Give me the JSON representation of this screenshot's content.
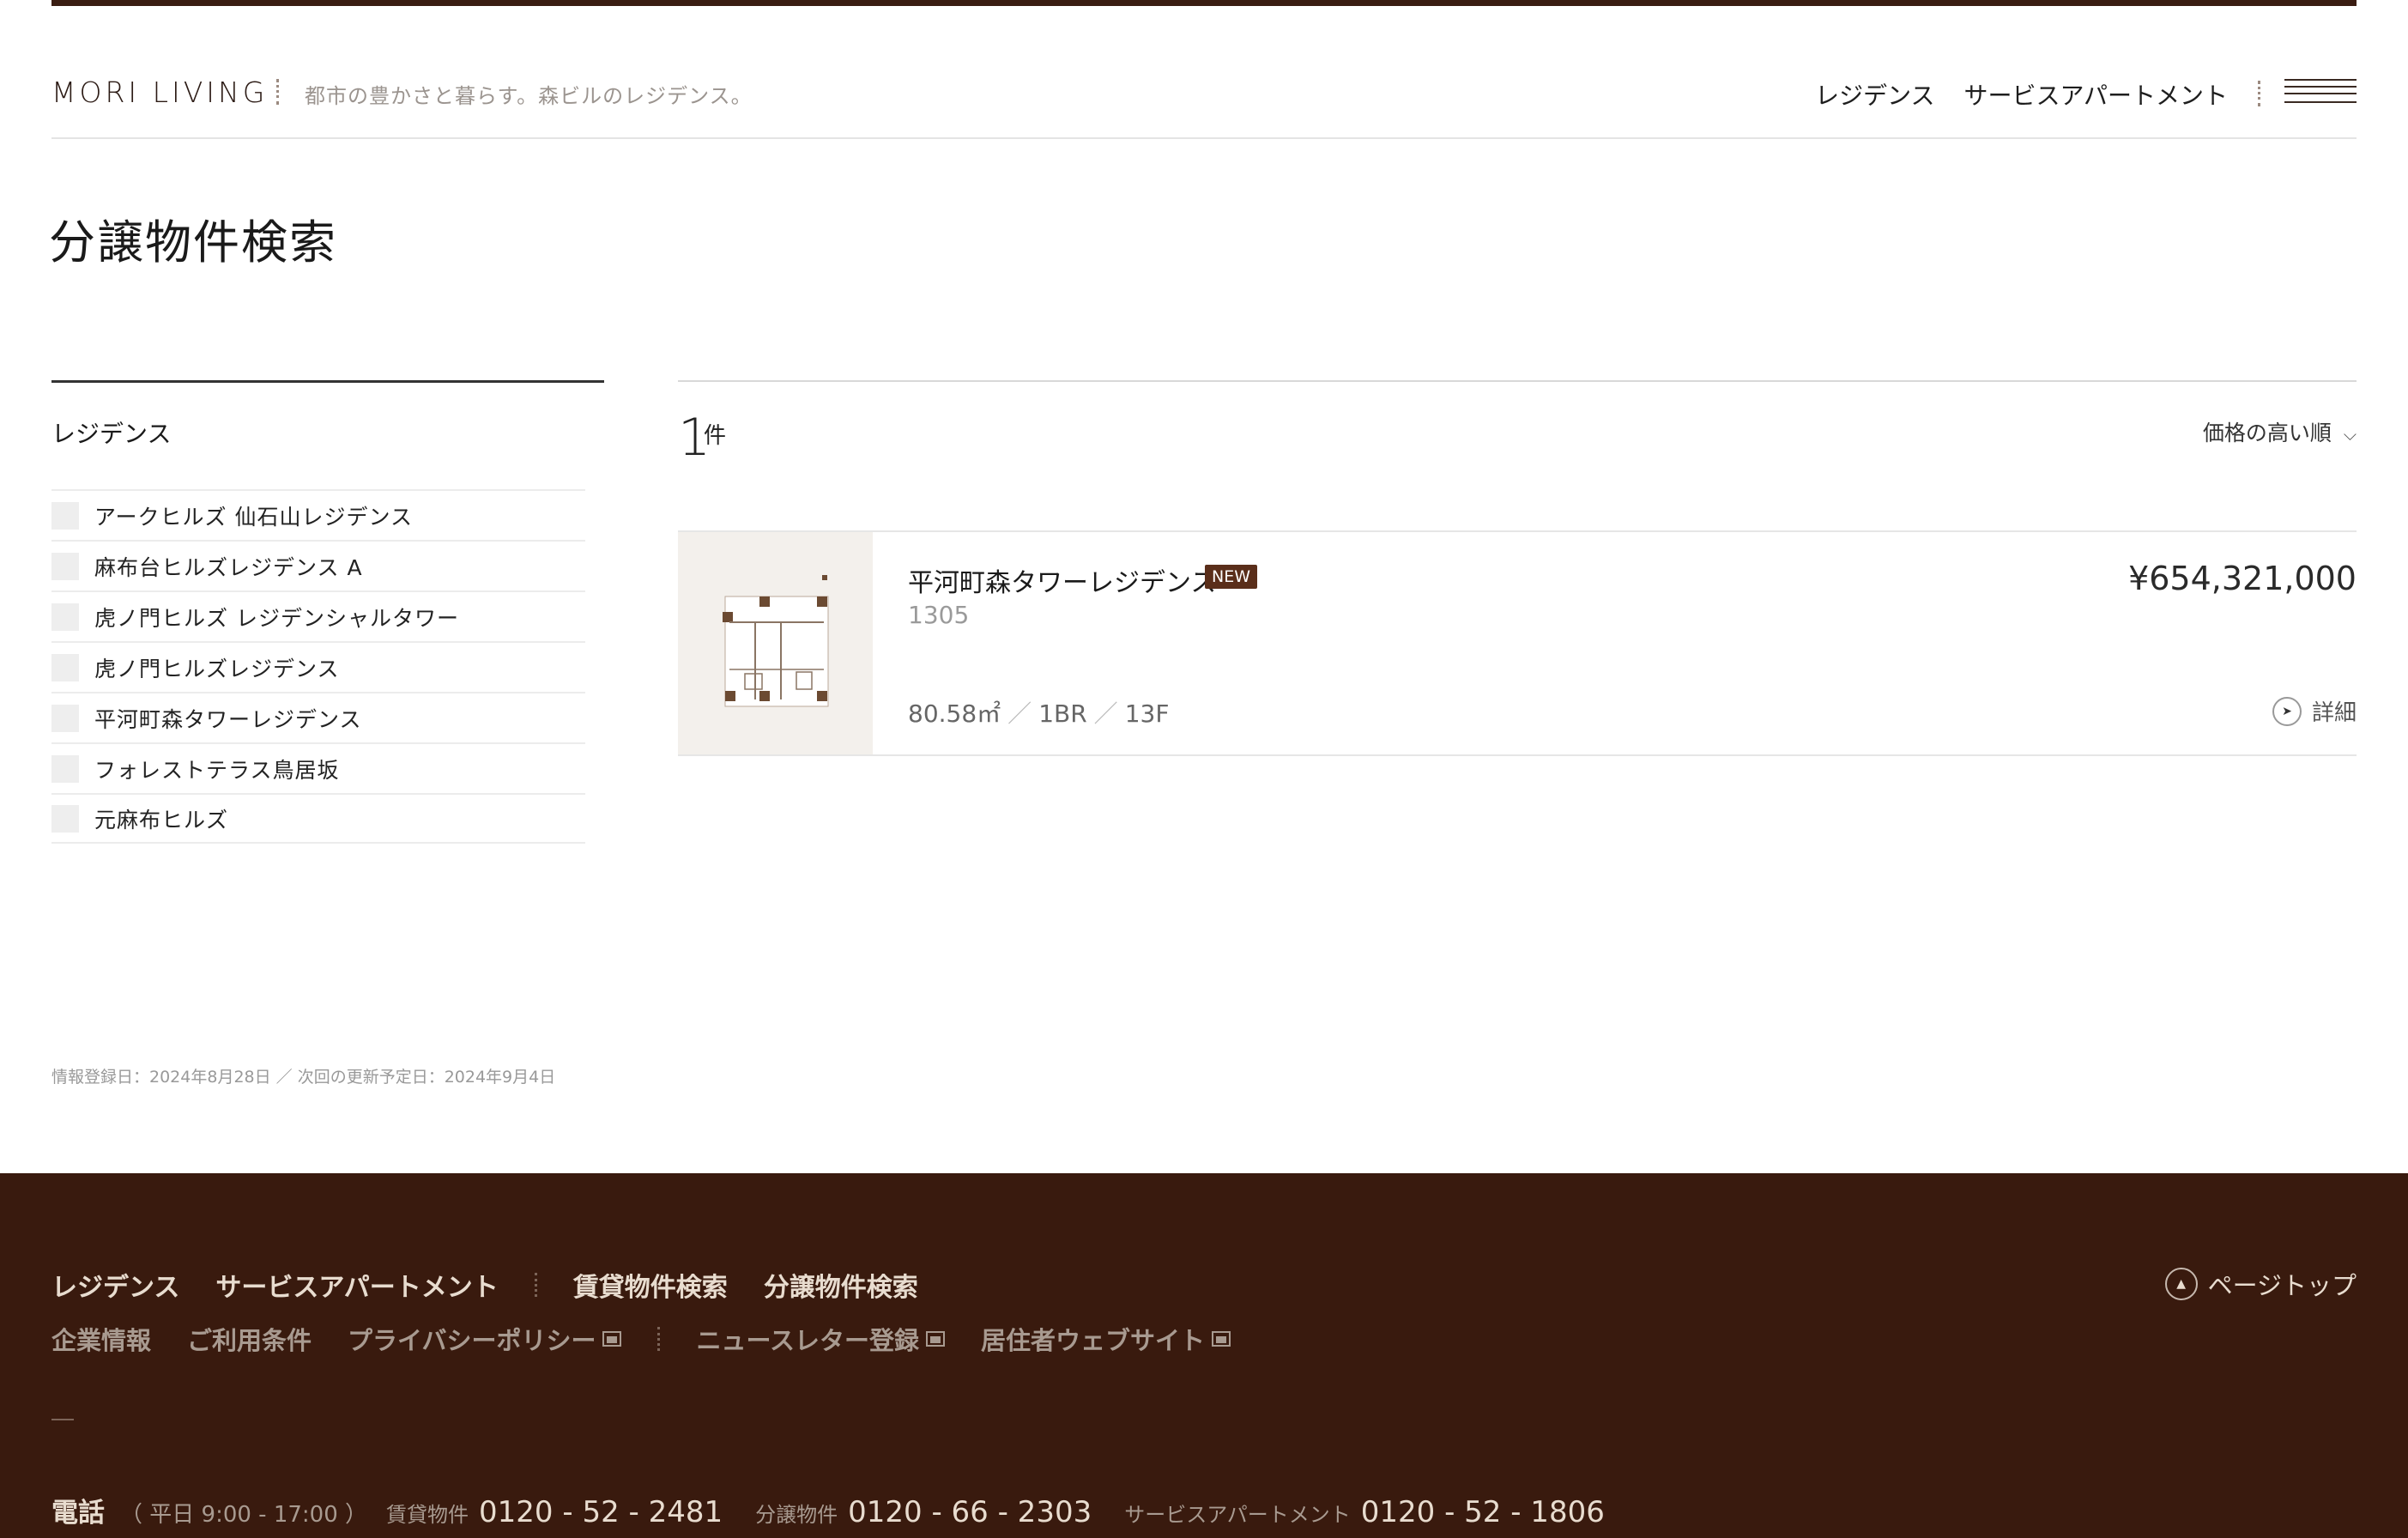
{
  "header": {
    "logo": "MORI LIVING",
    "tagline": "都市の豊かさと暮らす。森ビルのレジデンス。",
    "nav": [
      "レジデンス",
      "サービスアパートメント"
    ]
  },
  "page": {
    "title": "分譲物件検索"
  },
  "filter": {
    "title": "レジデンス",
    "items": [
      "アークヒルズ 仙石山レジデンス",
      "麻布台ヒルズレジデンス A",
      "虎ノ門ヒルズ レジデンシャルタワー",
      "虎ノ門ヒルズレジデンス",
      "平河町森タワーレジデンス",
      "フォレストテラス鳥居坂",
      "元麻布ヒルズ"
    ]
  },
  "results": {
    "count": "1",
    "count_unit": "件",
    "sort_label": "価格の高い順",
    "listing": {
      "name": "平河町森タワーレジデンス",
      "badge": "NEW",
      "room": "1305",
      "area": "80.58㎡",
      "layout": "1BR",
      "floor": "13F",
      "price": "¥654,321,000",
      "detail_label": "詳細"
    }
  },
  "updated_text": "情報登録日：2024年8月28日 ／ 次回の更新予定日：2024年9月4日",
  "footer": {
    "primary_links": [
      "レジデンス",
      "サービスアパートメント",
      "賃貸物件検索",
      "分譲物件検索"
    ],
    "secondary_links": [
      "企業情報",
      "ご利用条件",
      "プライバシーポリシー",
      "ニュースレター登録",
      "居住者ウェブサイト"
    ],
    "pagetop_label": "ページトップ",
    "phone": {
      "label": "電話",
      "hours": "（ 平日 9:00 - 17:00 ）",
      "entries": [
        {
          "category": "賃貸物件",
          "number": "0120 - 52 - 2481"
        },
        {
          "category": "分譲物件",
          "number": "0120 - 66 - 2303"
        },
        {
          "category": "サービスアパートメント",
          "number": "0120 - 52 - 1806"
        }
      ]
    }
  },
  "colors": {
    "brand_dark": "#391a0e",
    "badge": "#5a2e1a",
    "accent_light": "#e8dccf"
  }
}
